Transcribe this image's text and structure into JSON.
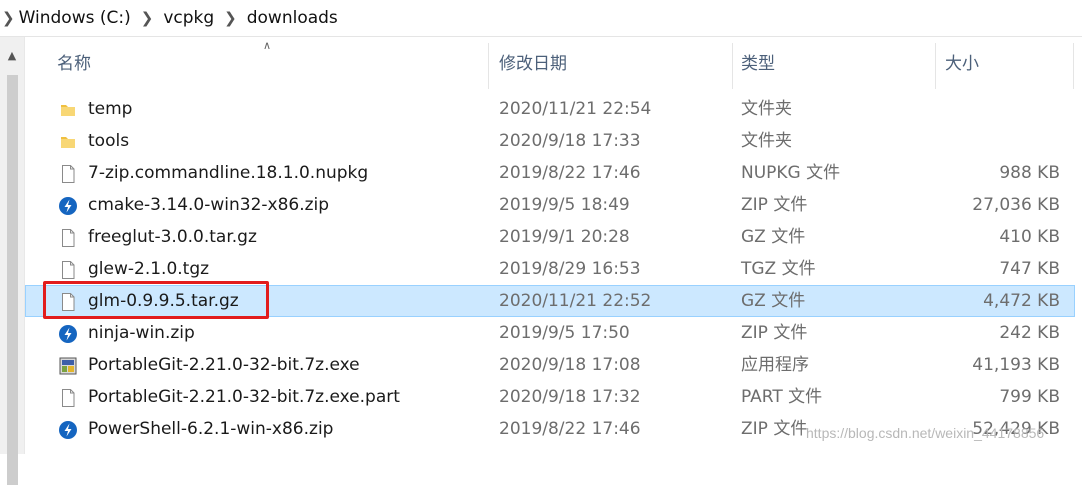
{
  "breadcrumb": [
    "Windows (C:)",
    "vcpkg",
    "downloads"
  ],
  "header": {
    "name": "名称",
    "date": "修改日期",
    "type": "类型",
    "size": "大小"
  },
  "files": [
    {
      "name": "temp",
      "date": "2020/11/21 22:54",
      "type": "文件夹",
      "size": "",
      "icon": "folder-icon"
    },
    {
      "name": "tools",
      "date": "2020/9/18 17:33",
      "type": "文件夹",
      "size": "",
      "icon": "folder-icon"
    },
    {
      "name": "7-zip.commandline.18.1.0.nupkg",
      "date": "2019/8/22 17:46",
      "type": "NUPKG 文件",
      "size": "988 KB",
      "icon": "file-icon"
    },
    {
      "name": "cmake-3.14.0-win32-x86.zip",
      "date": "2019/9/5 18:49",
      "type": "ZIP 文件",
      "size": "27,036 KB",
      "icon": "zip-app-icon"
    },
    {
      "name": "freeglut-3.0.0.tar.gz",
      "date": "2019/9/1 20:28",
      "type": "GZ 文件",
      "size": "410 KB",
      "icon": "file-icon"
    },
    {
      "name": "glew-2.1.0.tgz",
      "date": "2019/8/29 16:53",
      "type": "TGZ 文件",
      "size": "747 KB",
      "icon": "file-icon"
    },
    {
      "name": "glm-0.9.9.5.tar.gz",
      "date": "2020/11/21 22:52",
      "type": "GZ 文件",
      "size": "4,472 KB",
      "icon": "file-icon",
      "selected": true
    },
    {
      "name": "ninja-win.zip",
      "date": "2019/9/5 17:50",
      "type": "ZIP 文件",
      "size": "242 KB",
      "icon": "zip-app-icon"
    },
    {
      "name": "PortableGit-2.21.0-32-bit.7z.exe",
      "date": "2020/9/18 17:08",
      "type": "应用程序",
      "size": "41,193 KB",
      "icon": "installer-icon"
    },
    {
      "name": "PortableGit-2.21.0-32-bit.7z.exe.part",
      "date": "2020/9/18 17:32",
      "type": "PART 文件",
      "size": "799 KB",
      "icon": "file-icon"
    },
    {
      "name": "PowerShell-6.2.1-win-x86.zip",
      "date": "2019/8/22 17:46",
      "type": "ZIP 文件",
      "size": "52,429 KB",
      "icon": "zip-app-icon"
    }
  ],
  "watermark": "https://blog.csdn.net/weixin_44178856",
  "colors": {
    "selection_bg": "#cce8ff",
    "highlight_border": "#e21c1c",
    "folder": "#f8d775",
    "zip_icon": "#1565c0"
  }
}
